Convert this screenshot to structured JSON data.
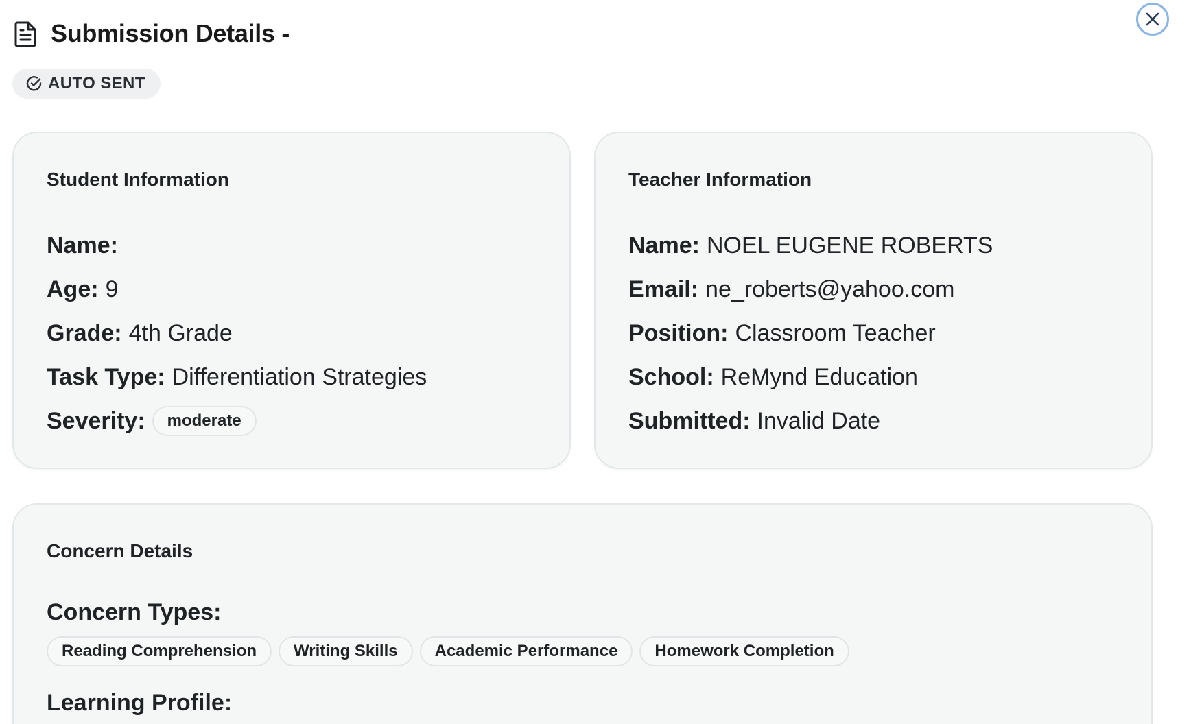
{
  "header": {
    "title": "Submission Details -",
    "status_badge": "AUTO SENT"
  },
  "student": {
    "heading": "Student Information",
    "name_label": "Name:",
    "name_value": "",
    "age_label": "Age:",
    "age_value": "9",
    "grade_label": "Grade:",
    "grade_value": "4th Grade",
    "task_label": "Task Type:",
    "task_value": "Differentiation Strategies",
    "severity_label": "Severity:",
    "severity_value": "moderate"
  },
  "teacher": {
    "heading": "Teacher Information",
    "name_label": "Name:",
    "name_value": "NOEL EUGENE ROBERTS",
    "email_label": "Email:",
    "email_value": "ne_roberts@yahoo.com",
    "position_label": "Position:",
    "position_value": "Classroom Teacher",
    "school_label": "School:",
    "school_value": "ReMynd Education",
    "submitted_label": "Submitted:",
    "submitted_value": "Invalid Date"
  },
  "concern": {
    "heading": "Concern Details",
    "types_label": "Concern Types:",
    "types": [
      "Reading Comprehension",
      "Writing Skills",
      "Academic Performance",
      "Homework Completion"
    ],
    "learning_profile_label": "Learning Profile:"
  },
  "icons": {
    "title": "document-icon",
    "close": "close-icon",
    "badge": "check-circle-icon"
  },
  "colors": {
    "card_bg": "#f5f7f7",
    "close_ring": "#8bb6e3",
    "badge_bg": "#eef0f1"
  }
}
